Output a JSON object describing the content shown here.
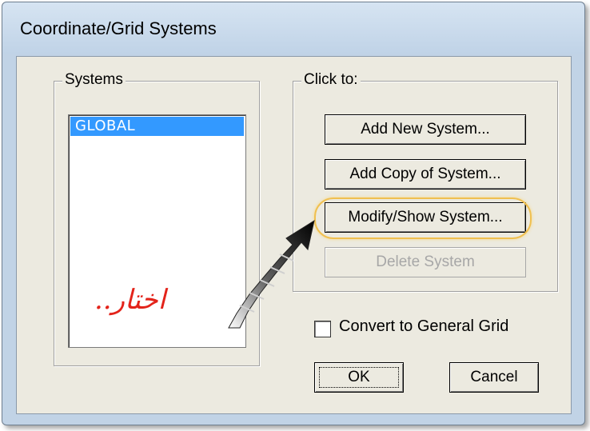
{
  "window": {
    "title": "Coordinate/Grid Systems"
  },
  "systems_group": {
    "label": "Systems",
    "items": [
      "GLOBAL"
    ]
  },
  "click_group": {
    "label": "Click to:",
    "buttons": {
      "add_new": "Add New System...",
      "add_copy": "Add Copy of System...",
      "modify_show": "Modify/Show System...",
      "delete": "Delete System"
    }
  },
  "convert_checkbox": {
    "label": "Convert to General Grid",
    "checked": false
  },
  "ok_label": "OK",
  "cancel_label": "Cancel",
  "annotation": {
    "text": "اختار..",
    "color": "#e3231a",
    "highlight_color": "#f0c050"
  }
}
